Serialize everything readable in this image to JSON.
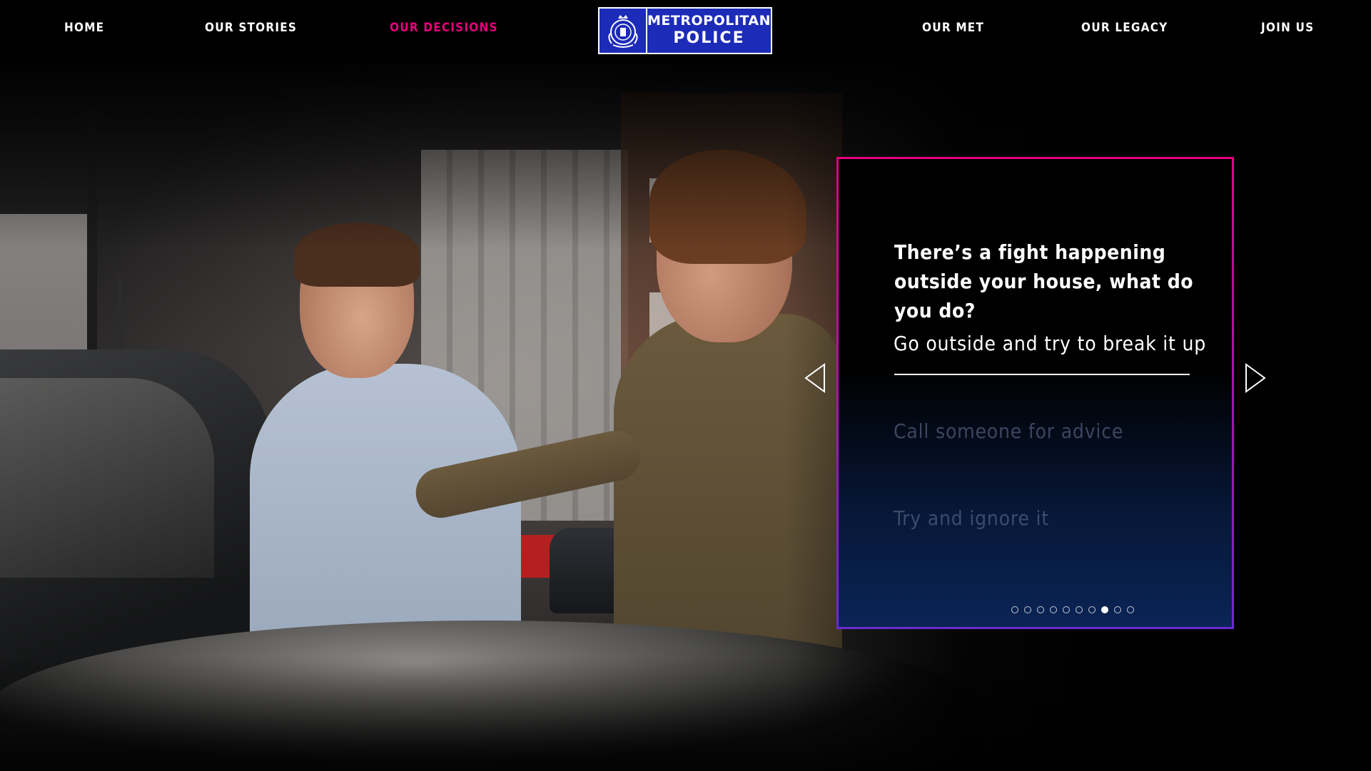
{
  "nav": {
    "items": [
      {
        "label": "HOME",
        "active": false
      },
      {
        "label": "OUR STORIES",
        "active": false
      },
      {
        "label": "OUR DECISIONS",
        "active": true
      },
      {
        "label": "OUR MET",
        "active": false
      },
      {
        "label": "OUR LEGACY",
        "active": false
      },
      {
        "label": "JOIN US",
        "active": false
      }
    ],
    "active_color": "#e6007e"
  },
  "logo": {
    "line1": "METROPOLITAN",
    "line2": "POLICE",
    "icon": "crest-icon",
    "background_color": "#1c2bb8"
  },
  "card": {
    "question": "There’s a fight happening outside your house, what do you do?",
    "answers": [
      {
        "label": "Go outside and try to break it up",
        "selected": true
      },
      {
        "label": "Call someone for advice",
        "selected": false
      },
      {
        "label": "Try and ignore it",
        "selected": false
      }
    ],
    "border_colors": [
      "#e6007e",
      "#6b2bd1"
    ]
  },
  "pagination": {
    "total": 10,
    "current": 8
  },
  "arrows": {
    "prev_icon": "triangle-left-icon",
    "next_icon": "triangle-right-icon"
  }
}
